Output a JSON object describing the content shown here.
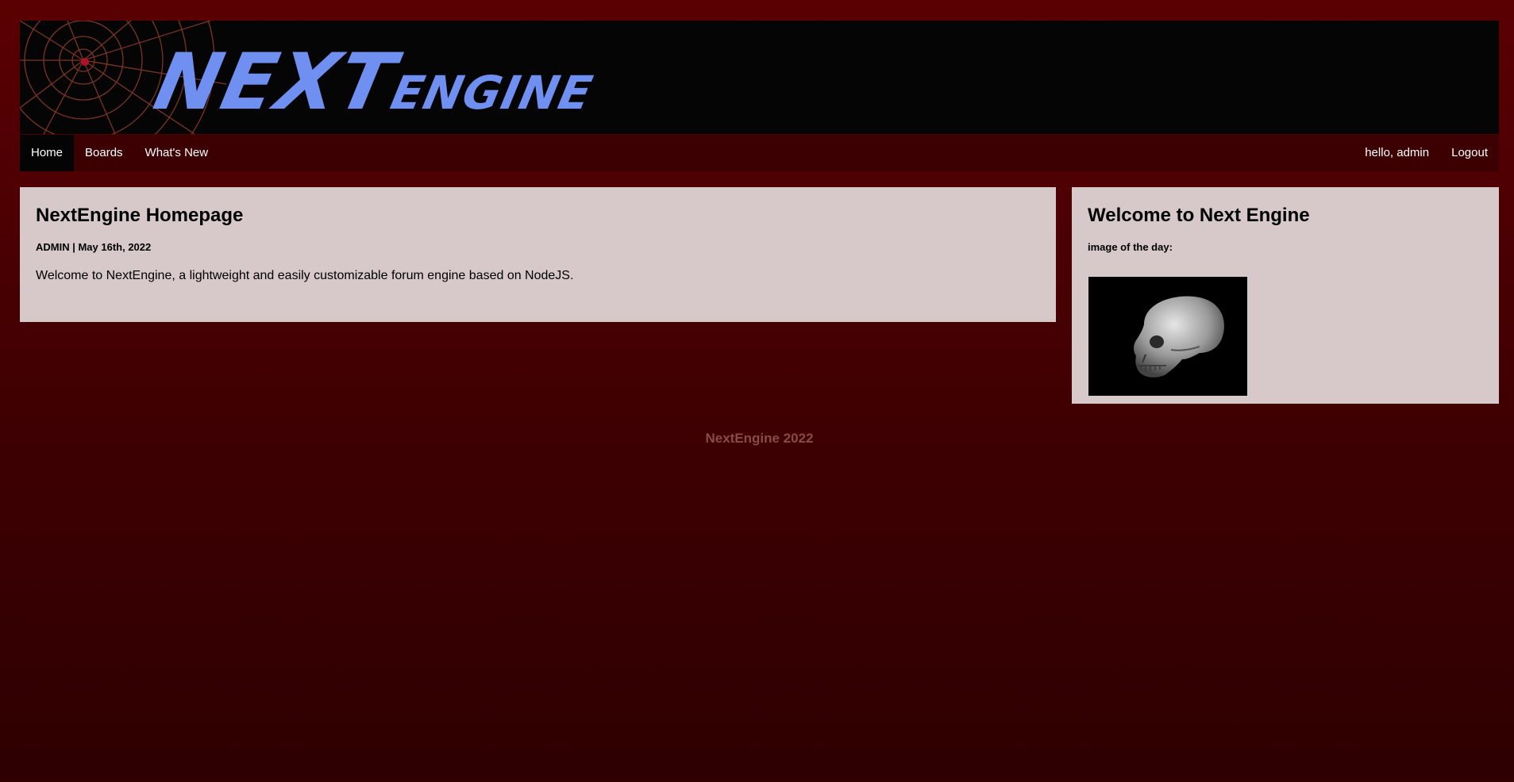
{
  "header": {
    "logo_main": "NEXT",
    "logo_sub": "ENGINE"
  },
  "nav": {
    "left": [
      {
        "label": "Home",
        "active": true
      },
      {
        "label": "Boards",
        "active": false
      },
      {
        "label": "What's New",
        "active": false
      }
    ],
    "greeting": "hello, admin",
    "logout": "Logout"
  },
  "main_post": {
    "title": "NextEngine Homepage",
    "meta": "ADMIN | May 16th, 2022",
    "body": "Welcome to NextEngine, a lightweight and easily customizable forum engine based on NodeJS."
  },
  "sidebar": {
    "title": "Welcome to Next Engine",
    "subtitle": "image of the day:"
  },
  "footer": {
    "text": "NextEngine 2022"
  },
  "colors": {
    "background": "#4a0002",
    "navbar": "#3d0002",
    "card": "#d7c9c9",
    "logo": "#6f90f0",
    "footer_text": "#8a4a4a"
  }
}
